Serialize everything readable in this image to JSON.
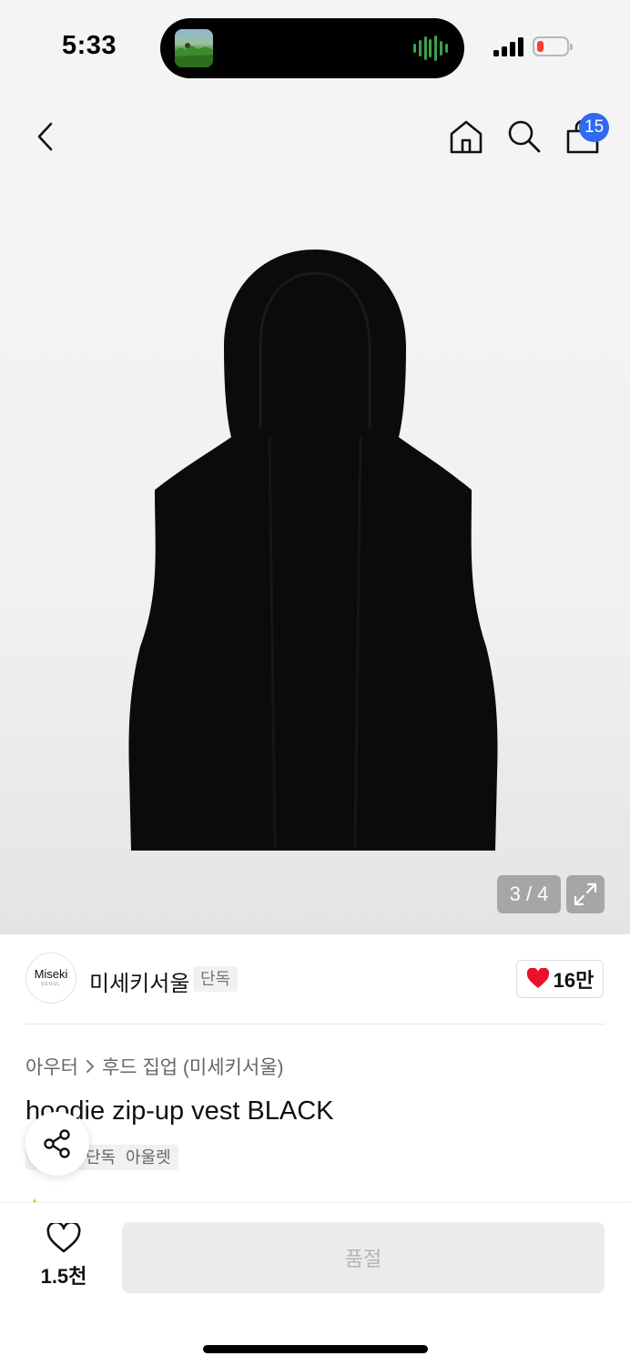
{
  "status_bar": {
    "time": "5:33"
  },
  "header": {
    "cart_count": "15",
    "icons": [
      "back-icon",
      "home-icon",
      "search-icon",
      "bag-icon"
    ]
  },
  "gallery": {
    "counter": "3 / 4"
  },
  "brand": {
    "logo_text": "Miseki",
    "logo_subtext": "SEOUL",
    "name": "미세키서울",
    "tag": "단독",
    "likes": "16만"
  },
  "product": {
    "breadcrumb": [
      "아우터",
      "후드 집업 (미세키서울)"
    ],
    "title": "hoodie zip-up vest BLACK",
    "tags": [
      "단독",
      "아울렛"
    ]
  },
  "bottom": {
    "wish_count": "1.5천",
    "buy_label": "품절"
  },
  "colors": {
    "accent": "#2f6bf2",
    "heart": "#e8132a",
    "disabled_bg": "#ebebeb"
  }
}
